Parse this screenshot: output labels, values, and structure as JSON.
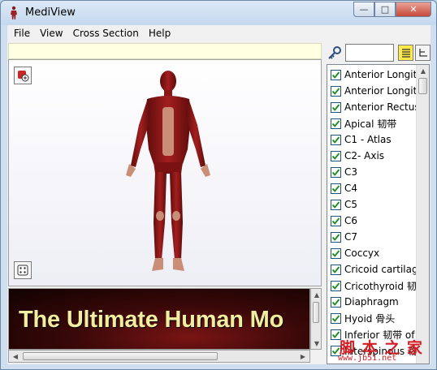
{
  "window": {
    "title": "MediView",
    "minimize_glyph": "—",
    "maximize_glyph": "□",
    "close_glyph": "✕"
  },
  "menu": [
    {
      "label": "File"
    },
    {
      "label": "View"
    },
    {
      "label": "Cross Section"
    },
    {
      "label": "Help"
    }
  ],
  "viewer": {
    "info_text": "",
    "banner_text": "The Ultimate Human Mo"
  },
  "search": {
    "value": ""
  },
  "structures": [
    {
      "label": "Anterior Longit",
      "checked": true
    },
    {
      "label": "Anterior Longit",
      "checked": true
    },
    {
      "label": "Anterior Rectus",
      "checked": true
    },
    {
      "label": "Apical 韧带",
      "checked": true
    },
    {
      "label": "C1 - Atlas",
      "checked": true
    },
    {
      "label": "C2- Axis",
      "checked": true
    },
    {
      "label": "C3",
      "checked": true
    },
    {
      "label": "C4",
      "checked": true
    },
    {
      "label": "C5",
      "checked": true
    },
    {
      "label": "C6",
      "checked": true
    },
    {
      "label": "C7",
      "checked": true
    },
    {
      "label": "Coccyx",
      "checked": true
    },
    {
      "label": "Cricoid cartilag",
      "checked": true
    },
    {
      "label": "Cricothyroid 韧",
      "checked": true
    },
    {
      "label": "Diaphragm",
      "checked": true
    },
    {
      "label": "Hyoid 骨头",
      "checked": true
    },
    {
      "label": "Inferior 韧带 of",
      "checked": true
    },
    {
      "label": "Interspinous 韧",
      "checked": true
    }
  ],
  "watermark": {
    "main": "脚 本 之 家",
    "sub": "www.jb51.net"
  },
  "colors": {
    "accent": "#ffe94d",
    "checkmark": "#1b8a1b",
    "banner_text": "#f1eea0"
  }
}
